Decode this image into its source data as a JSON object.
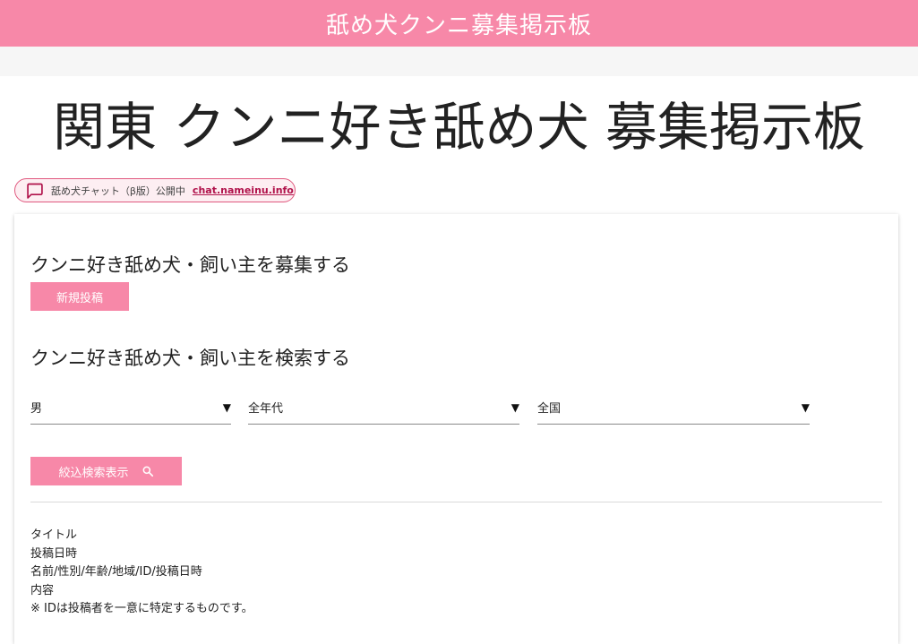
{
  "header": {
    "site_title": "舐め犬クンニ募集掲示板"
  },
  "page": {
    "title": "関東 クンニ好き舐め犬 募集掲示板"
  },
  "chat_banner": {
    "text": "舐め犬チャット（β版）公開中",
    "link": "chat.nameinu.info",
    "icon": "chat-bubble-icon",
    "border_color": "#e0597f",
    "link_color": "#b0114a"
  },
  "recruit": {
    "heading": "クンニ好き舐め犬・飼い主を募集する",
    "new_post_label": "新規投稿"
  },
  "search": {
    "heading": "クンニ好き舐め犬・飼い主を検索する",
    "gender_value": "男",
    "age_value": "全年代",
    "region_value": "全国",
    "dropdown_arrow": "▼",
    "submit_label": "絞込検索表示",
    "submit_icon": "search-icon"
  },
  "legend": {
    "line1": "タイトル",
    "line2": "投稿日時",
    "line3": "名前/性別/年齢/地域/ID/投稿日時",
    "line4": "内容",
    "line5": "※ IDは投稿者を一意に特定するものです。"
  },
  "colors": {
    "accent": "#f788a8",
    "subbar": "#f6f6f6"
  }
}
